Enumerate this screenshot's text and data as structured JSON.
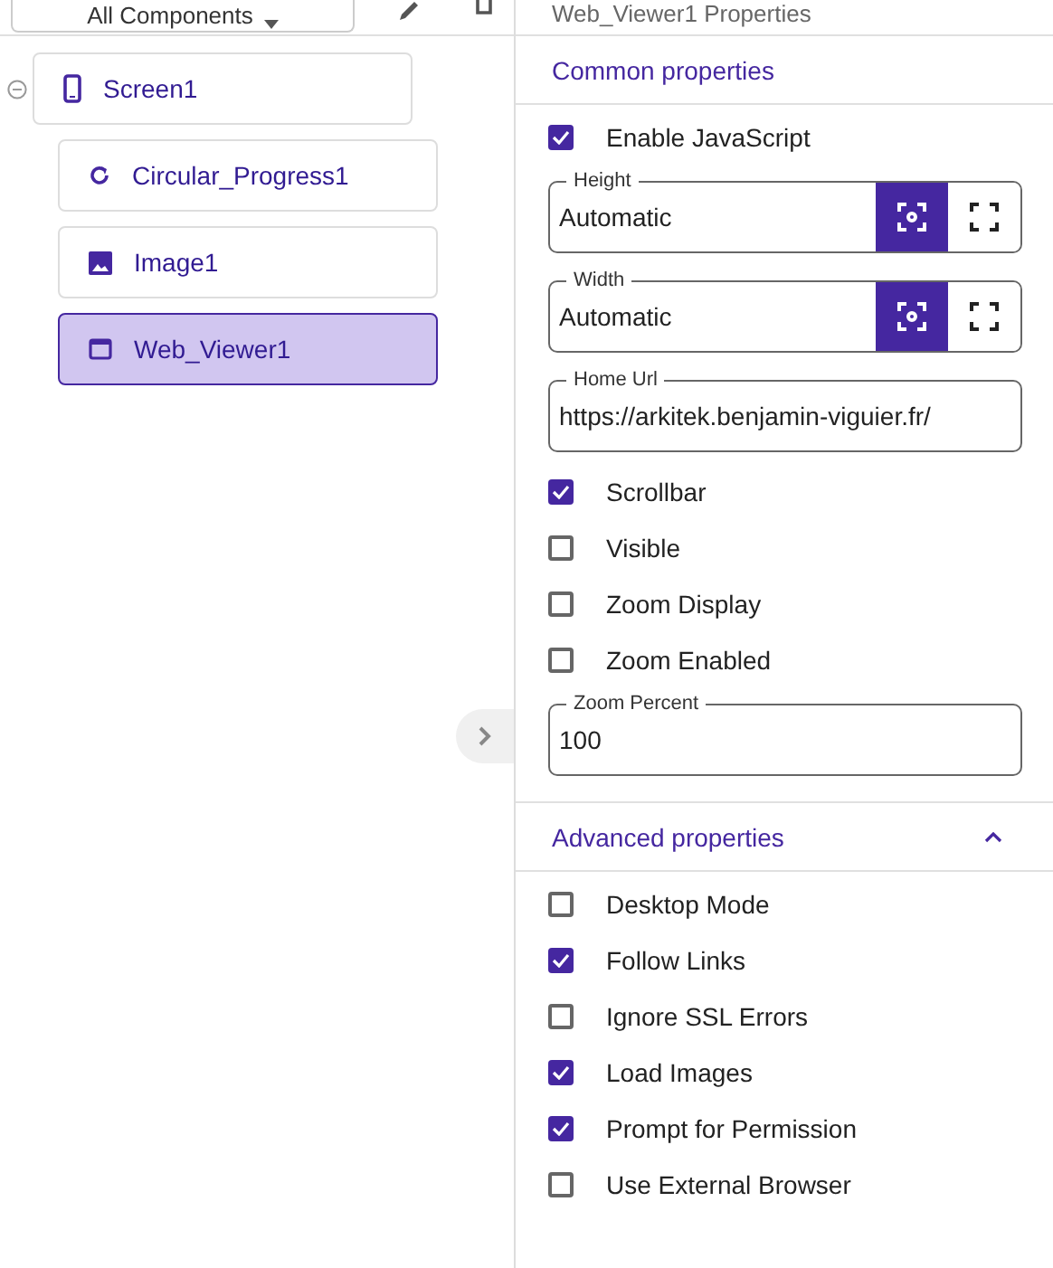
{
  "toolbar": {
    "filter": {
      "label": "All Components"
    }
  },
  "tree": [
    {
      "label": "Screen1",
      "kind": "screen",
      "expanded": true,
      "selected": false,
      "children": [
        {
          "label": "Circular_Progress1",
          "kind": "progress",
          "selected": false
        },
        {
          "label": "Image1",
          "kind": "image",
          "selected": false
        },
        {
          "label": "Web_Viewer1",
          "kind": "webviewer",
          "selected": true
        }
      ]
    }
  ],
  "properties": {
    "title": "Web_Viewer1 Properties",
    "sections": [
      {
        "title": "Common properties",
        "items": [
          {
            "kind": "checkbox",
            "label": "Enable JavaScript",
            "checked": true
          },
          {
            "kind": "size",
            "label": "Height",
            "value": "Automatic",
            "options": [
              {
                "selected": true
              },
              {
                "selected": false
              }
            ]
          },
          {
            "kind": "size",
            "label": "Width",
            "value": "Automatic",
            "options": [
              {
                "selected": true
              },
              {
                "selected": false
              }
            ]
          },
          {
            "kind": "text",
            "label": "Home Url",
            "value": "https://arkitek.benjamin-viguier.fr/"
          },
          {
            "kind": "checkbox",
            "label": "Scrollbar",
            "checked": true
          },
          {
            "kind": "checkbox",
            "label": "Visible",
            "checked": false
          },
          {
            "kind": "checkbox",
            "label": "Zoom Display",
            "checked": false
          },
          {
            "kind": "checkbox",
            "label": "Zoom Enabled",
            "checked": false
          },
          {
            "kind": "text",
            "label": "Zoom Percent",
            "value": "100"
          }
        ]
      },
      {
        "title": "Advanced properties",
        "expanded": true,
        "items": [
          {
            "kind": "checkbox",
            "label": "Desktop Mode",
            "checked": false
          },
          {
            "kind": "checkbox",
            "label": "Follow Links",
            "checked": true
          },
          {
            "kind": "checkbox",
            "label": "Ignore SSL Errors",
            "checked": false
          },
          {
            "kind": "checkbox",
            "label": "Load Images",
            "checked": true
          },
          {
            "kind": "checkbox",
            "label": "Prompt for Permission",
            "checked": true
          },
          {
            "kind": "checkbox",
            "label": "Use External Browser",
            "checked": false
          }
        ]
      }
    ]
  }
}
